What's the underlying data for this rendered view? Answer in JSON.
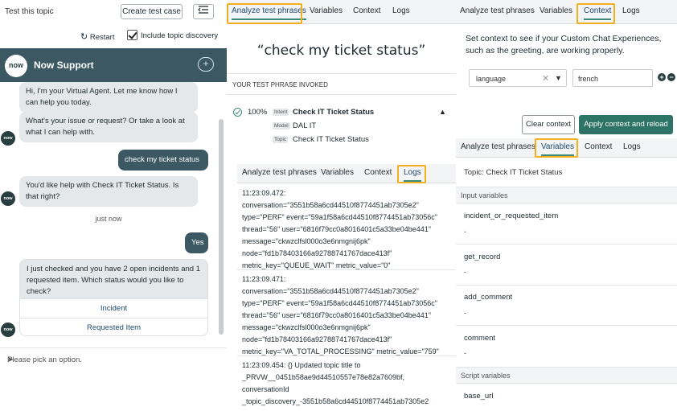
{
  "chat": {
    "test_topic_label": "Test this topic",
    "create_test_case": "Create test case",
    "collapse_icon": "collapse-icon",
    "restart": "Restart",
    "include_discovery": "Include topic discovery",
    "logo_text": "now",
    "title": "Now Support",
    "avatar_text": "now",
    "messages": {
      "m1": "Hi, I'm your Virtual Agent. Let me know how I can help you today.",
      "m2": "What's your issue or request? Or take a look at what I can help with.",
      "user1": "check my ticket status",
      "m3": "You'd like help with Check IT Ticket Status. Is that right?",
      "just_now": "just now",
      "user2": "Yes",
      "m4": "I just checked and you have 2 open incidents and 1 requested item.  Which status would you like to check?"
    },
    "options": [
      "Incident",
      "Requested Item"
    ],
    "input_placeholder": "Please pick an option."
  },
  "mid": {
    "tabs": [
      "Analyze test phrases",
      "Variables",
      "Context",
      "Logs"
    ],
    "phrase": "“check my ticket status”",
    "section_title": "YOUR TEST PHRASE INVOKED",
    "result": {
      "pct": "100%",
      "intent_tag": "Intent",
      "intent": "Check IT Ticket Status",
      "model_tag": "Model",
      "model": "DAL IT",
      "topic_tag": "Topic",
      "topic": "Check IT Ticket Status"
    },
    "log_tabs": [
      "Analyze test phrases",
      "Variables",
      "Context",
      "Logs"
    ],
    "logs": [
      [
        "11:23:09.472:",
        "conversation=\"3551b58a6cd44510f8774451ab7305e2\"",
        "type=\"PERF\" event=\"59a1f58a6cd44510f8774451ab73056c\"",
        "thread=\"56\" user=\"6816f79cc0a8016401c5a33be04be441\"",
        "message=\"ckwzclfsl000o3e6nmgnij6pk\"",
        "node=\"fd1b78403166a92788741767dace413f\"",
        "metric_key=\"QUEUE_WAIT\" metric_value=\"0\""
      ],
      [
        "11:23:09.471:",
        "conversation=\"3551b58a6cd44510f8774451ab7305e2\"",
        "type=\"PERF\" event=\"59a1f58a6cd44510f8774451ab73056c\"",
        "thread=\"56\" user=\"6816f79cc0a8016401c5a33be04be441\"",
        "message=\"ckwzclfsl000o3e6nmgnij6pk\"",
        "node=\"fd1b78403166a92788741767dace413f\"",
        "metric_key=\"VA_TOTAL_PROCESSING\" metric_value=\"759\""
      ],
      [
        "11:23:09.454: {} Updated topic title to",
        "_PRVW__0451b58ae9d44510557e78e82a7609bf,",
        "conversationId",
        "_topic_discovery_-3551b58a6cd44510f8774451ab7305e2"
      ]
    ]
  },
  "right": {
    "tabs": [
      "Analyze test phrases",
      "Variables",
      "Context",
      "Logs"
    ],
    "context_text": "Set context to see if your Custom Chat Experiences, such as the greeting, are working properly.",
    "select_value": "language",
    "input_value": "french",
    "clear": "Clear context",
    "apply": "Apply context and reload",
    "var_tabs": [
      "Analyze test phrases",
      "Variables",
      "Context",
      "Logs"
    ],
    "topic_line": "Topic:  Check IT Ticket Status",
    "input_vars_head": "Input variables",
    "vars": [
      {
        "name": "incident_or_requested_item",
        "value": "-"
      },
      {
        "name": "get_record",
        "value": "-"
      },
      {
        "name": "add_comment",
        "value": "-"
      },
      {
        "name": "comment",
        "value": "-"
      }
    ],
    "script_vars_head": "Script variables",
    "script_vars": [
      {
        "name": "base_url"
      }
    ]
  },
  "colors": {
    "header": "#3c5963",
    "accent": "#3c8a7a",
    "highlight": "#f2b01e",
    "apply": "#2e7466"
  }
}
